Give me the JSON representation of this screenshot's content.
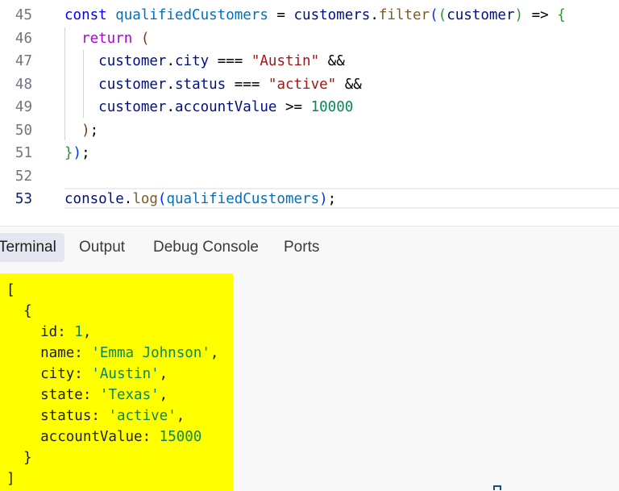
{
  "editor": {
    "lines": [
      {
        "n": "45",
        "tokens": [
          {
            "t": "const",
            "c": "kw"
          },
          {
            "t": " "
          },
          {
            "t": "qualifiedCustomers",
            "c": "var"
          },
          {
            "t": " = "
          },
          {
            "t": "customers",
            "c": "vdark"
          },
          {
            "t": "."
          },
          {
            "t": "filter",
            "c": "fn"
          },
          {
            "t": "(",
            "c": "b1"
          },
          {
            "t": "(",
            "c": "b2"
          },
          {
            "t": "customer",
            "c": "vdark"
          },
          {
            "t": ")",
            "c": "b2"
          },
          {
            "t": " => "
          },
          {
            "t": "{",
            "c": "b2"
          }
        ]
      },
      {
        "n": "46",
        "tokens": [
          {
            "t": "  "
          },
          {
            "t": "return",
            "c": "kw2"
          },
          {
            "t": " "
          },
          {
            "t": "(",
            "c": "b3"
          }
        ]
      },
      {
        "n": "47",
        "tokens": [
          {
            "t": "    "
          },
          {
            "t": "customer",
            "c": "vdark"
          },
          {
            "t": "."
          },
          {
            "t": "city",
            "c": "vdark"
          },
          {
            "t": " === "
          },
          {
            "t": "\"Austin\"",
            "c": "str"
          },
          {
            "t": " &&"
          }
        ]
      },
      {
        "n": "48",
        "tokens": [
          {
            "t": "    "
          },
          {
            "t": "customer",
            "c": "vdark"
          },
          {
            "t": "."
          },
          {
            "t": "status",
            "c": "vdark"
          },
          {
            "t": " === "
          },
          {
            "t": "\"active\"",
            "c": "str"
          },
          {
            "t": " &&"
          }
        ]
      },
      {
        "n": "49",
        "tokens": [
          {
            "t": "    "
          },
          {
            "t": "customer",
            "c": "vdark"
          },
          {
            "t": "."
          },
          {
            "t": "accountValue",
            "c": "vdark"
          },
          {
            "t": " >= "
          },
          {
            "t": "10000",
            "c": "num"
          }
        ]
      },
      {
        "n": "50",
        "tokens": [
          {
            "t": "  "
          },
          {
            "t": ")",
            "c": "b3"
          },
          {
            "t": ";"
          }
        ]
      },
      {
        "n": "51",
        "tokens": [
          {
            "t": "}",
            "c": "b2"
          },
          {
            "t": ")",
            "c": "b1"
          },
          {
            "t": ";"
          }
        ]
      },
      {
        "n": "52",
        "tokens": []
      },
      {
        "n": "53",
        "active": true,
        "tokens": [
          {
            "t": "console",
            "c": "vdark"
          },
          {
            "t": "."
          },
          {
            "t": "log",
            "c": "fn"
          },
          {
            "t": "(",
            "c": "b1"
          },
          {
            "t": "qualifiedCustomers",
            "c": "var"
          },
          {
            "t": ")",
            "c": "b1"
          },
          {
            "t": ";"
          }
        ]
      }
    ]
  },
  "panel": {
    "tabs": [
      {
        "label": "Terminal",
        "active": true
      },
      {
        "label": "Output"
      },
      {
        "label": "Debug Console"
      },
      {
        "label": "Ports"
      }
    ]
  },
  "terminal": {
    "lines": [
      [
        {
          "t": "["
        }
      ],
      [
        {
          "t": "  {"
        }
      ],
      [
        {
          "t": "    id: "
        },
        {
          "t": "1",
          "c": "t-num"
        },
        {
          "t": ","
        }
      ],
      [
        {
          "t": "    name: "
        },
        {
          "t": "'Emma Johnson'",
          "c": "t-str"
        },
        {
          "t": ","
        }
      ],
      [
        {
          "t": "    city: "
        },
        {
          "t": "'Austin'",
          "c": "t-str"
        },
        {
          "t": ","
        }
      ],
      [
        {
          "t": "    state: "
        },
        {
          "t": "'Texas'",
          "c": "t-str"
        },
        {
          "t": ","
        }
      ],
      [
        {
          "t": "    status: "
        },
        {
          "t": "'active'",
          "c": "t-str"
        },
        {
          "t": ","
        }
      ],
      [
        {
          "t": "    accountValue: "
        },
        {
          "t": "15000",
          "c": "t-num"
        }
      ],
      [
        {
          "t": "  }"
        }
      ],
      [
        {
          "t": "]"
        }
      ]
    ]
  }
}
